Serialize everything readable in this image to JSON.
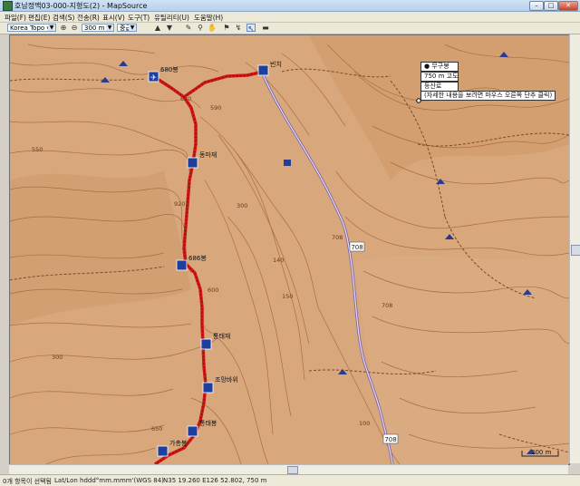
{
  "window": {
    "title": "호남정맥03-000-지형도(2) - MapSource"
  },
  "menu": [
    "파일(F)",
    "편집(E)",
    "검색(S)",
    "전송(R)",
    "표시(V)",
    "도구(T)",
    "유틸리티(U)",
    "도움말(H)"
  ],
  "toolbar": {
    "map_product": "Korea Topo v9",
    "zoom_scale": "300 m",
    "detail_level": "중급"
  },
  "map": {
    "waypoints": [
      {
        "label": "680봉"
      },
      {
        "label": "빈치"
      },
      {
        "label": "동마재"
      },
      {
        "label": "686봉"
      },
      {
        "label": "통태재"
      },
      {
        "label": "조망바위"
      },
      {
        "label": "통태봉"
      },
      {
        "label": "가총봉"
      }
    ],
    "elevation_labels": [
      "620",
      "920",
      "550",
      "300",
      "590",
      "600",
      "650",
      "300",
      "140",
      "150",
      "708",
      "708",
      "100"
    ],
    "road_labels": [
      "708",
      "708"
    ],
    "scale_bar": "300 m",
    "tooltip": {
      "name": "무구봉",
      "elevation": "750 m 고도",
      "category": "등산로",
      "hint": "(자세한 내용을 보려면 마우스 오른쪽 단추 클릭)"
    }
  },
  "status": {
    "selection": "0개 항목이 선택됨",
    "format": "Lat/Lon hddd°mm.mmm'(WGS 84)",
    "coords": "N35 19.260 E126 52.802, 750 m"
  },
  "colors": {
    "terrain": "#d8a77b",
    "contour": "#a0653c",
    "route": "#d01717",
    "road": "#7d64a8"
  }
}
